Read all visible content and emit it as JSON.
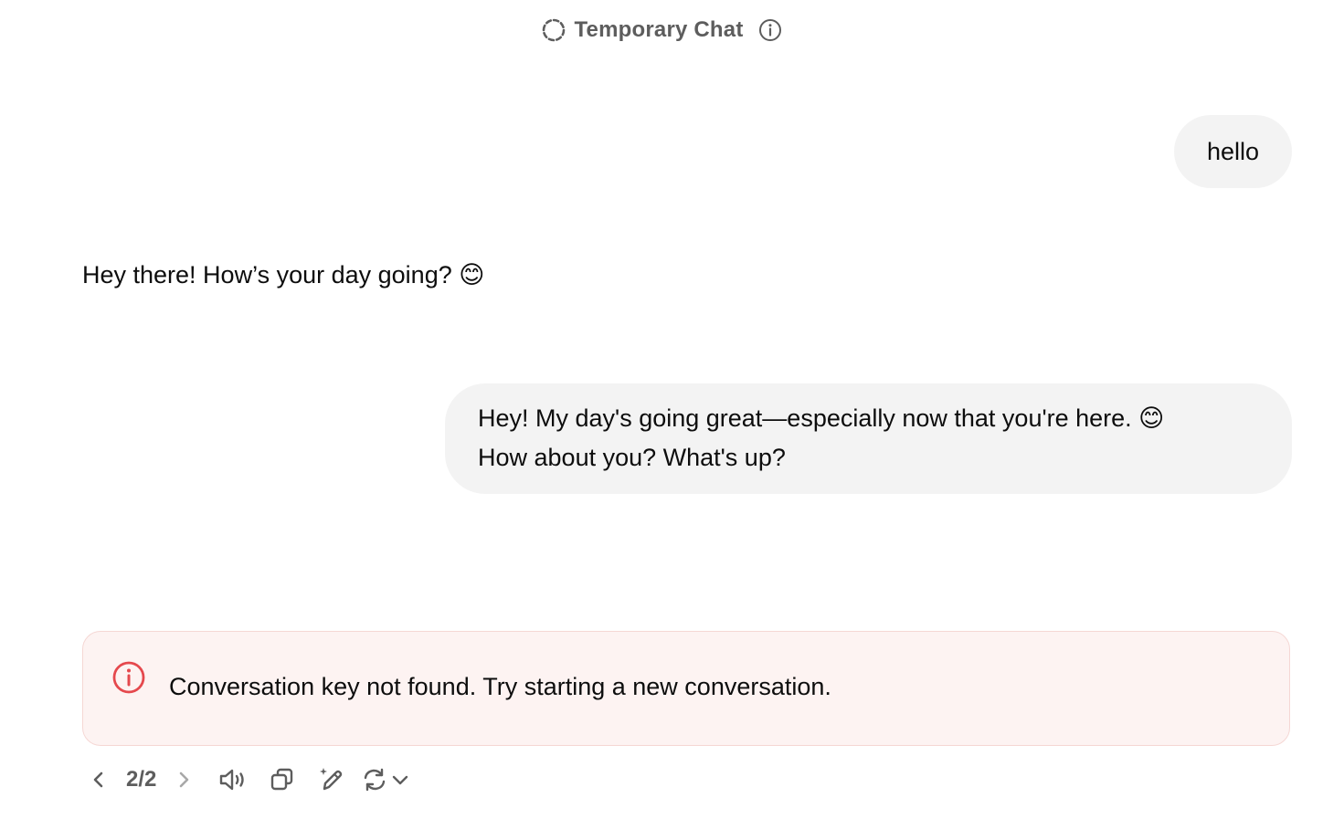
{
  "header": {
    "title": "Temporary Chat"
  },
  "messages": {
    "user_1": "hello",
    "assistant_1": "Hey there! How’s your day going? 😊",
    "user_2_line1": "Hey! My day's going great—especially now that you're here. 😊",
    "user_2_line2": "How about you? What's up?"
  },
  "error": {
    "text": "Conversation key not found. Try starting a new conversation.",
    "color": "#e5484d"
  },
  "toolbar": {
    "pager": "2/2",
    "icons": [
      "chevron-left-icon",
      "chevron-right-icon",
      "speaker-icon",
      "copy-icon",
      "edit-sparkle-icon",
      "regenerate-icon",
      "chevron-down-icon"
    ]
  }
}
